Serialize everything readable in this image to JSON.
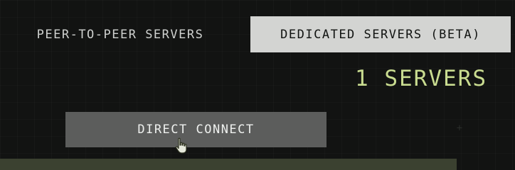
{
  "tabs": [
    {
      "label": "PEER-TO-PEER SERVERS",
      "selected": false
    },
    {
      "label": "DEDICATED SERVERS (BETA)",
      "selected": true
    }
  ],
  "server_count": "1 SERVERS",
  "direct_connect_label": "DIRECT CONNECT",
  "icons": {
    "cursor": "hand-pointer-icon",
    "decorations": "crosshair-icon"
  },
  "colors": {
    "background": "#121312",
    "selected_tab_bg": "#d3d4d2",
    "accent_green": "#c9dc90",
    "button_bg": "#5c5d5c",
    "bottom_bar": "#3b4130"
  }
}
